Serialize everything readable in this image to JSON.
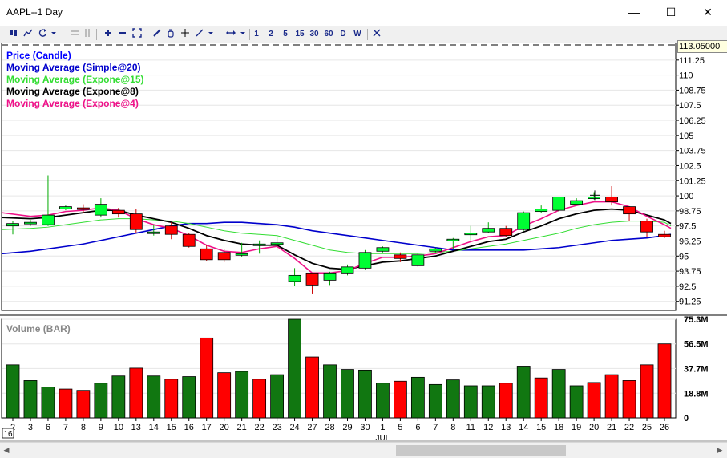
{
  "window": {
    "title": "AAPL--1 Day",
    "minimize": "—",
    "maximize": "☐",
    "close": "✕"
  },
  "toolbar": {
    "periods": [
      "1",
      "2",
      "5",
      "15",
      "30",
      "60",
      "D",
      "W"
    ]
  },
  "price_panel": {
    "last_price": "113.05000",
    "legend": [
      {
        "label": "Price (Candle)",
        "color": "#0000ff"
      },
      {
        "label": "Moving Average (Simple@20)",
        "color": "#0000cc"
      },
      {
        "label": "Moving Average (Expone@15)",
        "color": "#33dd33"
      },
      {
        "label": "Moving Average (Expone@8)",
        "color": "#000000"
      },
      {
        "label": "Moving Average (Expone@4)",
        "color": "#ee1188"
      }
    ]
  },
  "volume_panel": {
    "title": "Volume (BAR)"
  },
  "x_axis": {
    "month_label_1": "JUL",
    "first_label_box": "16"
  },
  "chart_data": [
    {
      "type": "candlestick",
      "title": "AAPL--1 Day",
      "y_ticks": [
        "111.25",
        "110",
        "108.75",
        "107.5",
        "106.25",
        "105",
        "103.75",
        "102.5",
        "101.25",
        "100",
        "98.75",
        "97.5",
        "96.25",
        "95",
        "93.75",
        "92.5",
        "91.25"
      ],
      "ylim": [
        90.5,
        112.7
      ],
      "dashed_line": 112.5,
      "x": [
        "2",
        "3",
        "6",
        "7",
        "8",
        "9",
        "10",
        "13",
        "14",
        "15",
        "16",
        "17",
        "20",
        "21",
        "22",
        "23",
        "24",
        "27",
        "28",
        "29",
        "30",
        "1",
        "5",
        "6",
        "7",
        "8",
        "11",
        "12",
        "13",
        "14",
        "15",
        "18",
        "19",
        "20",
        "21",
        "22",
        "25",
        "26"
      ],
      "open": [
        97.5,
        97.7,
        97.6,
        98.9,
        99.0,
        98.4,
        98.8,
        98.5,
        96.9,
        97.5,
        96.8,
        95.6,
        95.3,
        95.2,
        95.9,
        96.0,
        92.9,
        93.6,
        93.0,
        93.6,
        94.0,
        95.4,
        95.1,
        94.2,
        95.4,
        96.3,
        96.9,
        97.0,
        97.3,
        97.2,
        98.7,
        98.8,
        99.3,
        99.8,
        99.9,
        99.1,
        97.9,
        96.8
      ],
      "close": [
        97.7,
        97.8,
        98.4,
        99.1,
        98.9,
        99.3,
        98.5,
        97.2,
        97.0,
        96.8,
        95.8,
        94.7,
        94.7,
        95.2,
        96.0,
        96.1,
        93.4,
        92.6,
        93.6,
        94.1,
        95.3,
        95.7,
        94.8,
        95.1,
        95.6,
        96.4,
        96.9,
        97.3,
        96.7,
        98.6,
        98.9,
        99.9,
        99.6,
        99.9,
        99.5,
        98.5,
        97.0,
        96.6
      ],
      "high": [
        97.9,
        98.0,
        101.7,
        99.2,
        99.3,
        99.8,
        99.0,
        98.9,
        97.6,
        97.8,
        96.9,
        95.9,
        95.6,
        96.1,
        96.3,
        96.6,
        94.0,
        93.6,
        93.7,
        94.3,
        95.5,
        95.8,
        95.3,
        95.2,
        95.7,
        96.5,
        97.5,
        97.8,
        97.5,
        98.7,
        99.2,
        99.9,
        99.8,
        100.3,
        100.8,
        99.0,
        98.1,
        97.1
      ],
      "low": [
        96.8,
        97.5,
        97.5,
        98.8,
        98.6,
        98.2,
        98.2,
        96.9,
        96.7,
        96.4,
        95.7,
        94.6,
        94.5,
        94.9,
        95.2,
        95.5,
        92.5,
        91.9,
        92.6,
        93.4,
        93.9,
        95.3,
        94.5,
        94.1,
        95.3,
        95.6,
        96.3,
        96.9,
        96.6,
        97.1,
        98.6,
        98.7,
        99.3,
        99.7,
        99.2,
        97.9,
        96.6,
        96.5
      ],
      "series": [
        {
          "name": "Moving Average (Simple@20)",
          "values": [
            95.2,
            95.4,
            95.6,
            95.8,
            96.0,
            96.3,
            96.6,
            96.9,
            97.2,
            97.5,
            97.7,
            97.7,
            97.8,
            97.8,
            97.7,
            97.6,
            97.4,
            97.1,
            96.9,
            96.7,
            96.5,
            96.3,
            96.1,
            95.9,
            95.7,
            95.5,
            95.5,
            95.5,
            95.5,
            95.5,
            95.6,
            95.7,
            95.9,
            96.1,
            96.3,
            96.4,
            96.5,
            96.7
          ]
        },
        {
          "name": "Moving Average (Expone@15)",
          "values": [
            97.2,
            97.3,
            97.4,
            97.6,
            97.8,
            98.0,
            98.1,
            98.1,
            98.0,
            97.9,
            97.7,
            97.4,
            97.1,
            96.9,
            96.8,
            96.7,
            96.3,
            95.9,
            95.5,
            95.3,
            95.2,
            95.2,
            95.2,
            95.2,
            95.3,
            95.4,
            95.6,
            95.8,
            96.0,
            96.3,
            96.6,
            96.9,
            97.3,
            97.6,
            97.8,
            97.9,
            97.9,
            97.8
          ]
        },
        {
          "name": "Moving Average (Expone@8)",
          "values": [
            98.2,
            98.1,
            98.2,
            98.4,
            98.6,
            98.8,
            98.8,
            98.4,
            98.1,
            97.8,
            97.3,
            96.7,
            96.3,
            96.0,
            95.9,
            95.9,
            95.1,
            94.4,
            94.0,
            93.9,
            94.2,
            94.5,
            94.6,
            94.8,
            95.0,
            95.4,
            95.8,
            96.2,
            96.4,
            97.0,
            97.5,
            98.1,
            98.5,
            98.8,
            98.9,
            98.8,
            98.4,
            98.0
          ]
        },
        {
          "name": "Moving Average (Expone@4)",
          "values": [
            98.6,
            98.3,
            98.4,
            98.7,
            98.8,
            99.0,
            98.8,
            98.1,
            97.6,
            97.3,
            96.7,
            95.9,
            95.4,
            95.3,
            95.6,
            95.8,
            94.8,
            93.6,
            93.6,
            93.8,
            94.4,
            94.9,
            94.9,
            95.0,
            95.2,
            95.7,
            96.2,
            96.6,
            96.7,
            97.5,
            98.1,
            98.8,
            99.2,
            99.5,
            99.5,
            99.1,
            98.3,
            97.6
          ]
        }
      ]
    },
    {
      "type": "bar",
      "title": "Volume (BAR)",
      "y_ticks": [
        "75.3M",
        "56.5M",
        "37.7M",
        "18.8M",
        "0"
      ],
      "ylim": [
        0,
        75.3
      ],
      "categories": [
        "2",
        "3",
        "6",
        "7",
        "8",
        "9",
        "10",
        "13",
        "14",
        "15",
        "16",
        "17",
        "20",
        "21",
        "22",
        "23",
        "24",
        "27",
        "28",
        "29",
        "30",
        "1",
        "5",
        "6",
        "7",
        "8",
        "11",
        "12",
        "13",
        "14",
        "15",
        "18",
        "19",
        "20",
        "21",
        "22",
        "25",
        "26"
      ],
      "values": [
        40.5,
        28.5,
        23.5,
        22.0,
        21.0,
        26.5,
        32.0,
        38.0,
        32.0,
        29.5,
        31.5,
        61.0,
        34.5,
        35.5,
        29.5,
        33.0,
        75.3,
        46.5,
        40.5,
        37.0,
        36.5,
        26.5,
        28.0,
        31.0,
        25.5,
        29.0,
        24.5,
        24.5,
        26.5,
        39.5,
        30.5,
        37.0,
        24.5,
        27.0,
        33.0,
        28.5,
        40.5,
        56.5
      ],
      "colors": [
        "#117711",
        "#117711",
        "#117711",
        "#ff0000",
        "#ff0000",
        "#117711",
        "#117711",
        "#ff0000",
        "#117711",
        "#ff0000",
        "#117711",
        "#ff0000",
        "#ff0000",
        "#117711",
        "#ff0000",
        "#117711",
        "#117711",
        "#ff0000",
        "#117711",
        "#117711",
        "#117711",
        "#117711",
        "#ff0000",
        "#117711",
        "#117711",
        "#117711",
        "#117711",
        "#117711",
        "#ff0000",
        "#117711",
        "#ff0000",
        "#117711",
        "#117711",
        "#ff0000",
        "#ff0000",
        "#ff0000",
        "#ff0000",
        "#ff0000"
      ]
    }
  ]
}
